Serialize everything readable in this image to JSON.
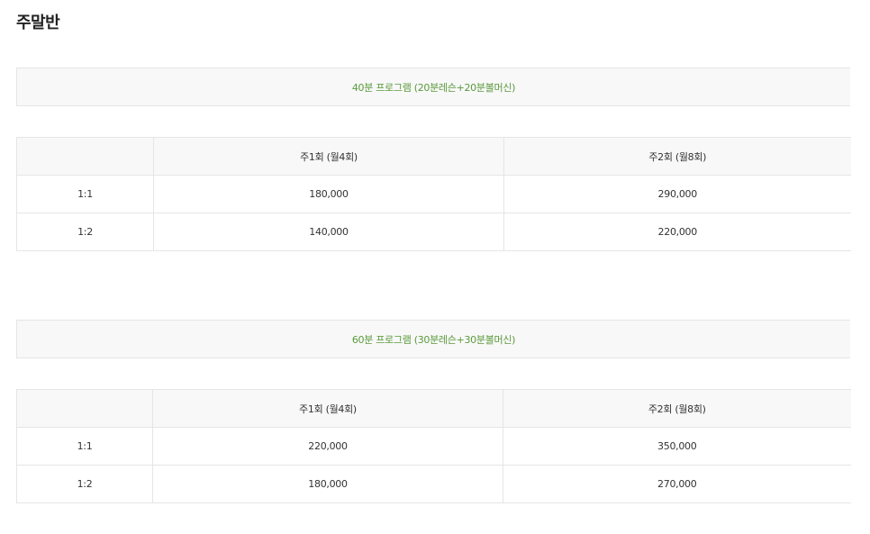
{
  "page": {
    "title": "주말반"
  },
  "programs": [
    {
      "title": "40분 프로그램 (20분레슨+20분볼머신)",
      "columns": [
        "",
        "주1회 (월4회)",
        "주2회 (월8회)"
      ],
      "rows": [
        {
          "type": "1:1",
          "weekly1": "180,000",
          "weekly2": "290,000"
        },
        {
          "type": "1:2",
          "weekly1": "140,000",
          "weekly2": "220,000"
        }
      ]
    },
    {
      "title": "60분 프로그램 (30분레슨+30분볼머신)",
      "columns": [
        "",
        "주1회 (월4회)",
        "주2회 (월8회)"
      ],
      "rows": [
        {
          "type": "1:1",
          "weekly1": "220,000",
          "weekly2": "350,000"
        },
        {
          "type": "1:2",
          "weekly1": "180,000",
          "weekly2": "270,000"
        }
      ]
    }
  ],
  "colors": {
    "accent": "#5a9a3c",
    "header_bg": "#f8f8f8",
    "border": "#e5e5e5"
  }
}
